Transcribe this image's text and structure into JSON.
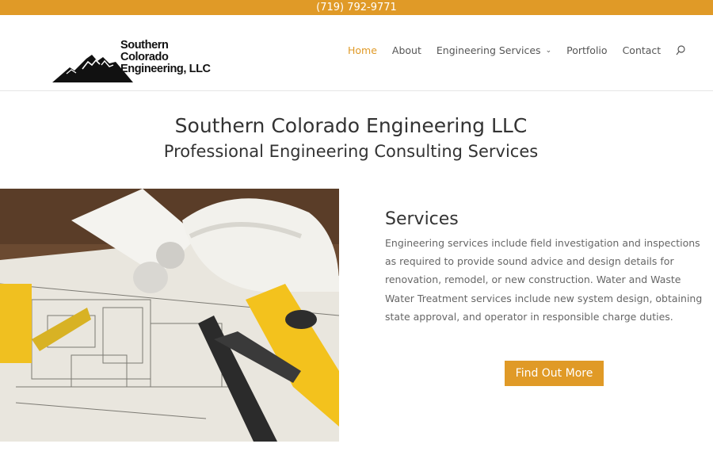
{
  "topbar": {
    "phone": "(719) 792-9771"
  },
  "header": {
    "logo": {
      "line1": "Southern Colorado",
      "line2": "Engineering, LLC"
    },
    "nav": [
      {
        "label": "Home",
        "active": true
      },
      {
        "label": "About"
      },
      {
        "label": "Engineering Services",
        "has_dropdown": true
      },
      {
        "label": "Portfolio"
      },
      {
        "label": "Contact"
      }
    ],
    "search_icon": "search-icon"
  },
  "hero": {
    "title": "Southern Colorado Engineering LLC",
    "subtitle": "Professional Engineering Consulting Services"
  },
  "services": {
    "heading": "Services",
    "body": "Engineering services include field investigation and inspections as required to provide sound advice and design details for renovation, remodel, or new construction. Water and Waste Water Treatment services  include new system design, obtaining state approval, and operator in responsible charge duties.",
    "button": "Find Out More"
  },
  "colors": {
    "accent": "#e09a27",
    "text": "#333333",
    "body_text": "#666666"
  }
}
